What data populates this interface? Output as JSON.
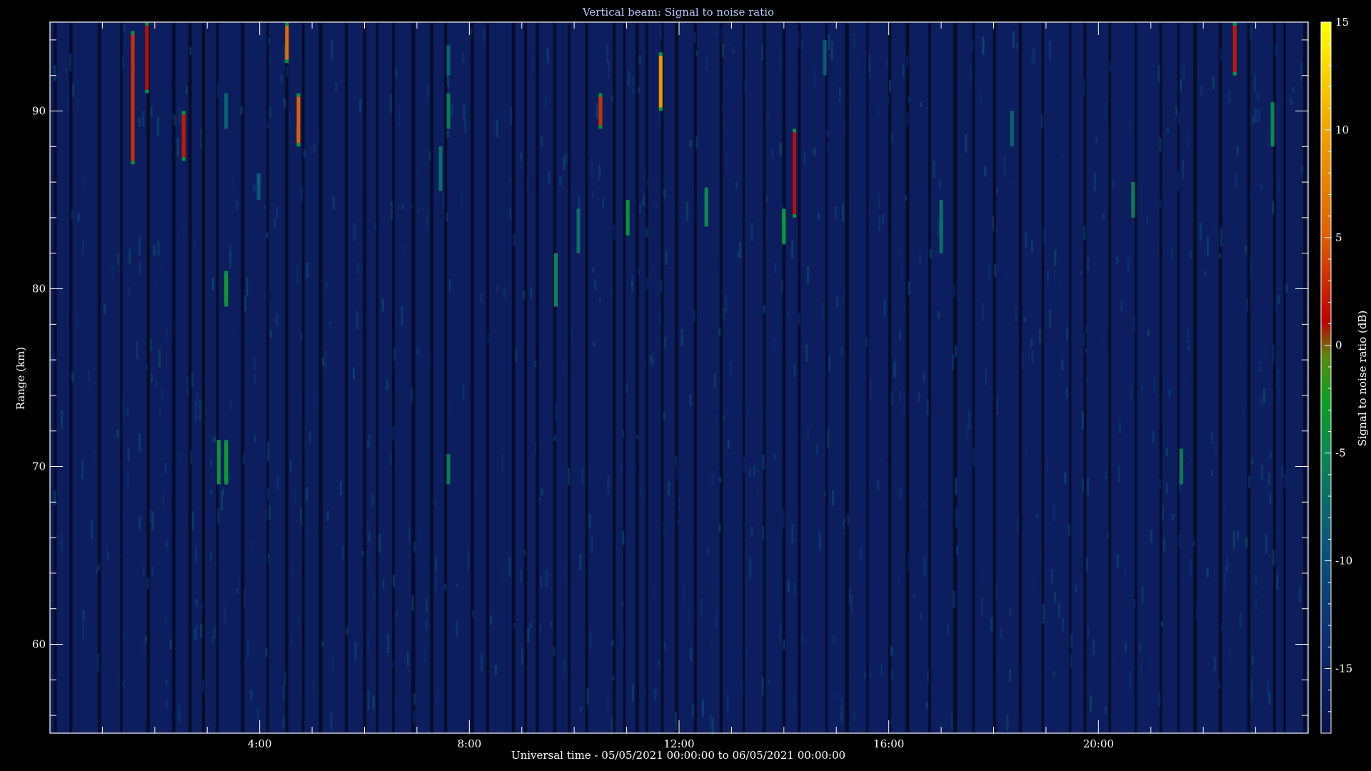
{
  "chart_data": {
    "type": "heatmap",
    "title": "Vertical beam: Signal to noise ratio",
    "xlabel": "Universal time - 05/05/2021 00:00:00 to 06/05/2021 00:00:00",
    "ylabel": "Range (km)",
    "colorbar_label": "Signal to noise ratio (dB)",
    "x_unit": "hours UT",
    "xlim": [
      0,
      24
    ],
    "ylim": [
      55,
      95
    ],
    "clim": [
      -18,
      15
    ],
    "x_ticks": [
      4,
      8,
      12,
      16,
      20
    ],
    "x_tick_labels": [
      "4:00",
      "8:00",
      "12:00",
      "16:00",
      "20:00"
    ],
    "y_ticks": [
      60,
      70,
      80,
      90
    ],
    "y_tick_labels": [
      "60",
      "70",
      "80",
      "90"
    ],
    "colorbar_ticks": [
      -15,
      -10,
      -5,
      0,
      5,
      10,
      15
    ],
    "colorbar_tick_labels": [
      "-15",
      "-10",
      "-5",
      "0",
      "5",
      "10",
      "15"
    ],
    "background_snr_db": -16,
    "colormap": [
      "#0a1245",
      "#0c2a70",
      "#0b5a78",
      "#0a8a50",
      "#0aa020",
      "#5a8a10",
      "#c00000",
      "#e06000",
      "#f0a000",
      "#ffff00"
    ],
    "echoes": [
      {
        "t": 1.58,
        "r0": 87.0,
        "r1": 94.5,
        "snr": 3
      },
      {
        "t": 1.85,
        "r0": 91.0,
        "r1": 95.0,
        "snr": 1
      },
      {
        "t": 2.55,
        "r0": 87.2,
        "r1": 90.0,
        "snr": 2
      },
      {
        "t": 3.22,
        "r0": 69.0,
        "r1": 71.5,
        "snr": -4
      },
      {
        "t": 3.36,
        "r0": 69.0,
        "r1": 71.5,
        "snr": -3
      },
      {
        "t": 3.36,
        "r0": 79.0,
        "r1": 81.0,
        "snr": -3
      },
      {
        "t": 3.36,
        "r0": 89.0,
        "r1": 91.0,
        "snr": -8
      },
      {
        "t": 3.98,
        "r0": 85.0,
        "r1": 86.5,
        "snr": -9
      },
      {
        "t": 4.52,
        "r0": 92.7,
        "r1": 95.0,
        "snr": 6
      },
      {
        "t": 4.74,
        "r0": 88.0,
        "r1": 91.0,
        "snr": 5
      },
      {
        "t": 7.45,
        "r0": 85.5,
        "r1": 88.0,
        "snr": -7
      },
      {
        "t": 7.6,
        "r0": 92.0,
        "r1": 93.7,
        "snr": -8
      },
      {
        "t": 7.6,
        "r0": 89.0,
        "r1": 91.0,
        "snr": -6
      },
      {
        "t": 7.6,
        "r0": 69.0,
        "r1": 70.7,
        "snr": -6
      },
      {
        "t": 9.65,
        "r0": 79.0,
        "r1": 82.0,
        "snr": -5
      },
      {
        "t": 10.08,
        "r0": 82.0,
        "r1": 84.5,
        "snr": -7
      },
      {
        "t": 10.5,
        "r0": 89.0,
        "r1": 91.0,
        "snr": 3
      },
      {
        "t": 11.02,
        "r0": 83.0,
        "r1": 85.0,
        "snr": -4
      },
      {
        "t": 11.65,
        "r0": 90.0,
        "r1": 93.3,
        "snr": 9
      },
      {
        "t": 12.52,
        "r0": 83.5,
        "r1": 85.7,
        "snr": -5
      },
      {
        "t": 14.0,
        "r0": 82.5,
        "r1": 84.5,
        "snr": -3
      },
      {
        "t": 14.2,
        "r0": 84.0,
        "r1": 89.0,
        "snr": 1
      },
      {
        "t": 14.78,
        "r0": 92.0,
        "r1": 94.0,
        "snr": -9
      },
      {
        "t": 17.0,
        "r0": 82.0,
        "r1": 85.0,
        "snr": -7
      },
      {
        "t": 18.35,
        "r0": 88.0,
        "r1": 90.0,
        "snr": -8
      },
      {
        "t": 20.66,
        "r0": 84.0,
        "r1": 86.0,
        "snr": -6
      },
      {
        "t": 21.58,
        "r0": 69.0,
        "r1": 71.0,
        "snr": -6
      },
      {
        "t": 22.6,
        "r0": 92.0,
        "r1": 95.0,
        "snr": 2
      },
      {
        "t": 23.32,
        "r0": 88.0,
        "r1": 90.5,
        "snr": -5
      }
    ]
  }
}
